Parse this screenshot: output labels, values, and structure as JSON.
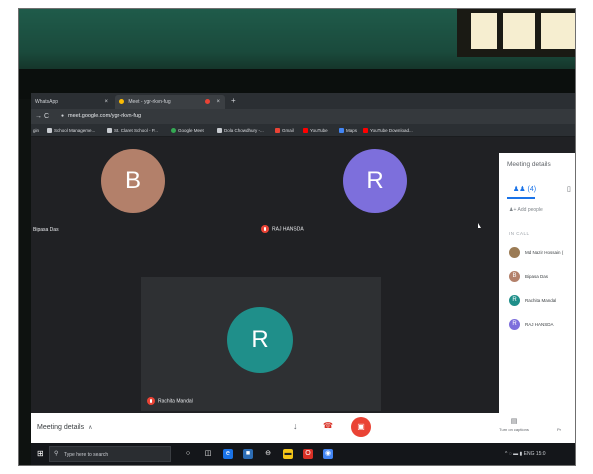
{
  "browser": {
    "tabs": [
      {
        "label": "WhatsApp",
        "close": "×"
      },
      {
        "label": "Meet - ygr-rkvn-fug",
        "close": "×"
      }
    ],
    "new_tab": "+",
    "nav": "→ C",
    "url": "meet.google.com/ygr-rkvn-fug",
    "bookmarks": [
      "gin",
      "School Manageme...",
      "St. Claret School - P...",
      "Google Meet",
      "Dola Chowdhury -...",
      "Gmail",
      "YouTube",
      "Maps",
      "YouTube Download..."
    ]
  },
  "participants_grid": [
    {
      "initial": "B",
      "name": "Bipasa Das",
      "color": "#b3806a"
    },
    {
      "initial": "R",
      "name": "RAJ HANSDA",
      "color": "#7d6fdc"
    },
    {
      "initial": "R",
      "name": "Rachita Mandal",
      "color": "#1f8f8a"
    }
  ],
  "panel": {
    "title": "Meeting details",
    "people_tab": "(4)",
    "add_people": "Add people",
    "section_label": "IN CALL",
    "people": [
      {
        "name": "Md Nazir Hossain (",
        "initial": "",
        "color": "#9b7b55"
      },
      {
        "name": "Bipasa Das",
        "initial": "B",
        "color": "#b3806a"
      },
      {
        "name": "Rachita Mandal",
        "initial": "R",
        "color": "#1f8f8a"
      },
      {
        "name": "RAJ HANSDA",
        "initial": "R",
        "color": "#7d6fdc"
      }
    ]
  },
  "bottom_bar": {
    "meeting_details": "Meeting details",
    "captions_label": "Turn on captions",
    "present_label": "Pr"
  },
  "taskbar": {
    "search_placeholder": "Type here to search",
    "tray": "^ ◌ ▬ ▮ ENG 15:0"
  },
  "colors": {
    "meet_bg": "#202124",
    "hangup_red": "#ea4335",
    "accent_blue": "#1a73e8"
  }
}
